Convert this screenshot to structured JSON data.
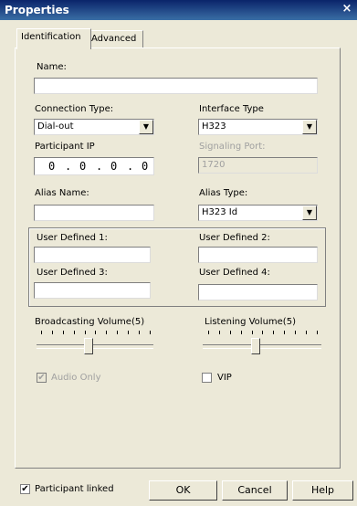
{
  "window": {
    "title": "Properties",
    "close_glyph": "×"
  },
  "tabs": [
    {
      "label": "Identification"
    },
    {
      "label": "Advanced"
    }
  ],
  "fields": {
    "name_label": "Name:",
    "name_value": "",
    "connection_type_label": "Connection Type:",
    "connection_type_value": "Dial-out",
    "interface_type_label": "Interface Type",
    "interface_type_value": "H323",
    "participant_ip_label": "Participant IP",
    "participant_ip_octets": [
      "0",
      "0",
      "0",
      "0"
    ],
    "ip_separator": ".",
    "signaling_port_label": "Signaling Port:",
    "signaling_port_value": "1720",
    "alias_name_label": "Alias Name:",
    "alias_name_value": "",
    "alias_type_label": "Alias Type:",
    "alias_type_value": "H323 Id",
    "user_defined_1_label": "User Defined 1:",
    "user_defined_2_label": "User Defined 2:",
    "user_defined_3_label": "User Defined 3:",
    "user_defined_4_label": "User Defined 4:"
  },
  "sliders": {
    "broadcasting_label": "Broadcasting Volume(5)",
    "broadcasting_level": 5,
    "listening_label": "Listening Volume(5)",
    "listening_level": 5
  },
  "checkboxes": {
    "audio_only_label": "Audio Only",
    "audio_only_checked": true,
    "vip_label": "VIP",
    "vip_checked": false,
    "participant_linked_label": "Participant linked",
    "participant_linked_checked": true
  },
  "buttons": {
    "ok": "OK",
    "cancel": "Cancel",
    "help": "Help"
  },
  "icons": {
    "dropdown": "dropdown-arrow-icon",
    "check": "✔"
  }
}
